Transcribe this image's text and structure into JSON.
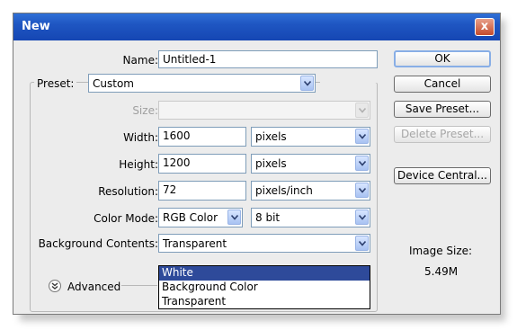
{
  "window": {
    "title": "New",
    "close_glyph": "x"
  },
  "form": {
    "name_label": "Name:",
    "name_value": "Untitled-1",
    "preset_label": "Preset:",
    "preset_value": "Custom",
    "size_label": "Size:",
    "size_value": "",
    "width_label": "Width:",
    "width_value": "1600",
    "width_unit": "pixels",
    "height_label": "Height:",
    "height_value": "1200",
    "height_unit": "pixels",
    "resolution_label": "Resolution:",
    "resolution_value": "72",
    "resolution_unit": "pixels/inch",
    "color_mode_label": "Color Mode:",
    "color_mode_value": "RGB Color",
    "bit_depth_value": "8 bit",
    "background_label": "Background Contents:",
    "background_value": "Transparent",
    "background_options": [
      "White",
      "Background Color",
      "Transparent"
    ],
    "background_highlighted": "White",
    "advanced_label": "Advanced"
  },
  "buttons": {
    "ok": "OK",
    "cancel": "Cancel",
    "save_preset": "Save Preset...",
    "delete_preset": "Delete Preset...",
    "device_central": "Device Central..."
  },
  "info": {
    "image_size_label": "Image Size:",
    "image_size_value": "5.49M"
  },
  "colors": {
    "titlebar": "#1f56c2",
    "highlight": "#2e4a9a",
    "dialog_bg": "#ececec"
  },
  "icons": {
    "close": "close-icon",
    "dropdown": "chevron-down-icon",
    "advanced": "double-chevron-down-icon"
  }
}
